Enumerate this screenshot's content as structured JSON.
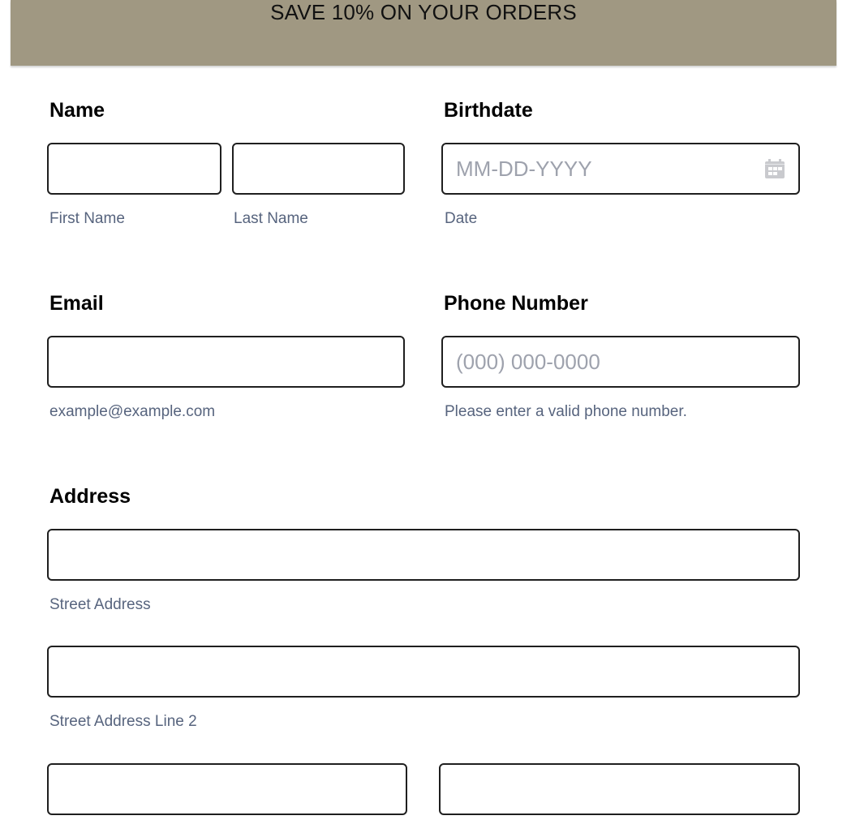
{
  "banner": {
    "text": "SAVE 10% ON YOUR ORDERS",
    "background": "#a09882"
  },
  "form": {
    "name": {
      "label": "Name",
      "first": {
        "value": "",
        "sublabel": "First Name"
      },
      "last": {
        "value": "",
        "sublabel": "Last Name"
      }
    },
    "birthdate": {
      "label": "Birthdate",
      "value": "",
      "placeholder": "MM-DD-YYYY",
      "sublabel": "Date",
      "icon": "calendar-icon"
    },
    "email": {
      "label": "Email",
      "value": "",
      "sublabel": "example@example.com"
    },
    "phone": {
      "label": "Phone Number",
      "value": "",
      "placeholder": "(000) 000-0000",
      "sublabel": "Please enter a valid phone number."
    },
    "address": {
      "label": "Address",
      "street1": {
        "value": "",
        "sublabel": "Street Address"
      },
      "street2": {
        "value": "",
        "sublabel": "Street Address Line 2"
      },
      "city": {
        "value": ""
      },
      "state": {
        "value": ""
      }
    }
  },
  "colors": {
    "sublabel": "#57647e",
    "placeholder": "#9ea2ad",
    "border": "#1f1f1f"
  }
}
